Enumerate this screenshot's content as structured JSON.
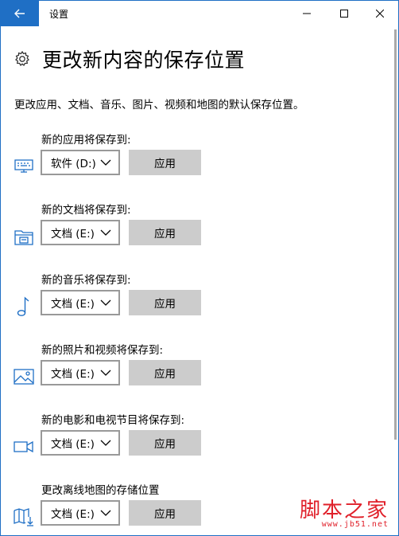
{
  "window": {
    "title": "设置"
  },
  "page": {
    "title": "更改新内容的保存位置",
    "description": "更改应用、文档、音乐、图片、视频和地图的默认保存位置。"
  },
  "sections": [
    {
      "label": "新的应用将保存到:",
      "icon": "monitor-icon",
      "drive": "软件 (D:)",
      "apply": "应用"
    },
    {
      "label": "新的文档将保存到:",
      "icon": "documents-folder-icon",
      "drive": "文档 (E:)",
      "apply": "应用"
    },
    {
      "label": "新的音乐将保存到:",
      "icon": "music-note-icon",
      "drive": "文档 (E:)",
      "apply": "应用"
    },
    {
      "label": "新的照片和视频将保存到:",
      "icon": "picture-icon",
      "drive": "文档 (E:)",
      "apply": "应用"
    },
    {
      "label": "新的电影和电视节目将保存到:",
      "icon": "video-camera-icon",
      "drive": "文档 (E:)",
      "apply": "应用"
    },
    {
      "label": "更改离线地图的存储位置",
      "icon": "map-download-icon",
      "drive": "文档 (E:)",
      "apply": "应用"
    }
  ],
  "watermark": {
    "brand": "脚本之家",
    "url": "www.jb51.net"
  },
  "colors": {
    "accent": "#1f6fc5",
    "button_bg": "#cccccc",
    "watermark": "#e0202a"
  }
}
